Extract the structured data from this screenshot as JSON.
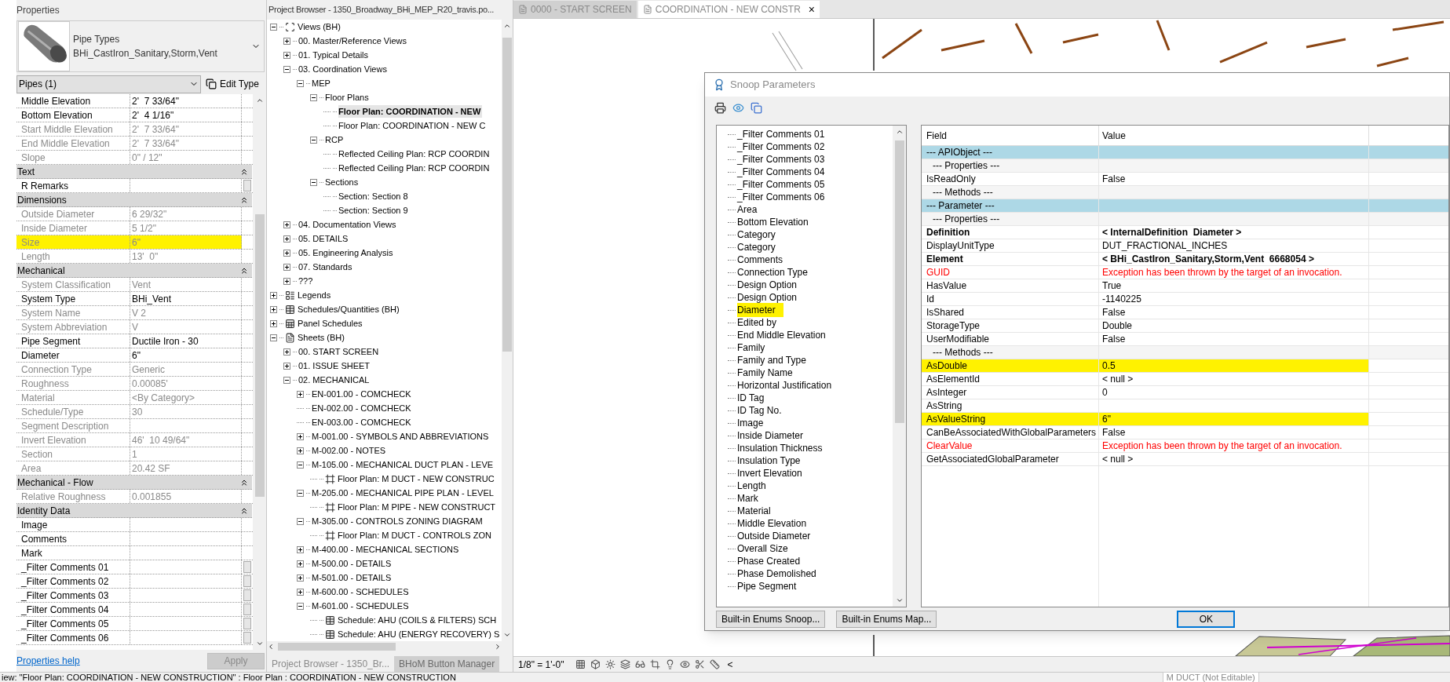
{
  "properties": {
    "title": "Properties",
    "type_family": "Pipe Types",
    "type_name": "BHi_CastIron_Sanitary,Storm,Vent",
    "instance_filter": "Pipes (1)",
    "edit_type": "Edit Type",
    "rows": [
      {
        "kind": "row",
        "label": "Middle Elevation",
        "value": "2'  7 33/64\"",
        "disabled": false
      },
      {
        "kind": "row",
        "label": "Bottom Elevation",
        "value": "2'  4 1/16\"",
        "disabled": false
      },
      {
        "kind": "row",
        "label": "Start Middle Elevation",
        "value": "2'  7 33/64\"",
        "disabled": true
      },
      {
        "kind": "row",
        "label": "End Middle Elevation",
        "value": "2'  7 33/64\"",
        "disabled": true
      },
      {
        "kind": "row",
        "label": "Slope",
        "value": "0\" / 12\"",
        "disabled": true
      },
      {
        "kind": "group",
        "label": "Text",
        "expanded": true
      },
      {
        "kind": "row",
        "label": "R Remarks",
        "disabled": false,
        "button": true
      },
      {
        "kind": "group",
        "label": "Dimensions",
        "expanded": true
      },
      {
        "kind": "row",
        "label": "Outside Diameter",
        "value": "6 29/32\"",
        "disabled": true
      },
      {
        "kind": "row",
        "label": "Inside Diameter",
        "value": "5 1/2\"",
        "disabled": true
      },
      {
        "kind": "row",
        "label": "Size",
        "value": "6\"",
        "disabled": true,
        "highlighted": true
      },
      {
        "kind": "row",
        "label": "Length",
        "value": "13'  0\"",
        "disabled": true
      },
      {
        "kind": "group",
        "label": "Mechanical",
        "expanded": true
      },
      {
        "kind": "row",
        "label": "System Classification",
        "value": "Vent",
        "disabled": true
      },
      {
        "kind": "row",
        "label": "System Type",
        "value": "BHi_Vent",
        "disabled": false
      },
      {
        "kind": "row",
        "label": "System Name",
        "value": "V 2",
        "disabled": true
      },
      {
        "kind": "row",
        "label": "System Abbreviation",
        "value": "V",
        "disabled": true
      },
      {
        "kind": "row",
        "label": "Pipe Segment",
        "value": "Ductile Iron - 30",
        "disabled": false
      },
      {
        "kind": "row",
        "label": "Diameter",
        "value": "6\"",
        "disabled": false
      },
      {
        "kind": "row",
        "label": "Connection Type",
        "value": "Generic",
        "disabled": true
      },
      {
        "kind": "row",
        "label": "Roughness",
        "value": "0.00085'",
        "disabled": true
      },
      {
        "kind": "row",
        "label": "Material",
        "value": "<By Category>",
        "disabled": true
      },
      {
        "kind": "row",
        "label": "Schedule/Type",
        "value": "30",
        "disabled": true
      },
      {
        "kind": "row",
        "label": "Segment Description",
        "disabled": true
      },
      {
        "kind": "row",
        "label": "Invert Elevation",
        "value": "46'  10 49/64\"",
        "disabled": true
      },
      {
        "kind": "row",
        "label": "Section",
        "value": "1",
        "disabled": true
      },
      {
        "kind": "row",
        "label": "Area",
        "value": "20.42 SF",
        "disabled": true
      },
      {
        "kind": "group",
        "label": "Mechanical - Flow",
        "expanded": true
      },
      {
        "kind": "row",
        "label": "Relative Roughness",
        "value": "0.001855",
        "disabled": true
      },
      {
        "kind": "group",
        "label": "Identity Data",
        "expanded": true
      },
      {
        "kind": "row",
        "label": "Image",
        "disabled": false
      },
      {
        "kind": "row",
        "label": "Comments",
        "disabled": false
      },
      {
        "kind": "row",
        "label": "Mark",
        "disabled": false
      },
      {
        "kind": "row",
        "label": "_Filter Comments 01",
        "disabled": false,
        "button": true
      },
      {
        "kind": "row",
        "label": "_Filter Comments 02",
        "disabled": false,
        "button": true
      },
      {
        "kind": "row",
        "label": "_Filter Comments 03",
        "disabled": false,
        "button": true
      },
      {
        "kind": "row",
        "label": "_Filter Comments 04",
        "disabled": false,
        "button": true
      },
      {
        "kind": "row",
        "label": "_Filter Comments 05",
        "disabled": false,
        "button": true
      },
      {
        "kind": "row",
        "label": "_Filter Comments 06",
        "disabled": false,
        "button": true
      }
    ],
    "help_link": "Properties help",
    "apply": {
      "label": "Apply",
      "disabled": true
    }
  },
  "project_browser": {
    "title": "Project Browser - 1350_Broadway_BHi_MEP_R20_travis.po...",
    "tree": [
      {
        "label": "Views (BH)",
        "kind": "views",
        "expanded": true,
        "children": [
          {
            "label": "00. Master/Reference Views",
            "expanded": false
          },
          {
            "label": "01. Typical Details",
            "expanded": false
          },
          {
            "label": "03. Coordination Views",
            "expanded": true,
            "children": [
              {
                "label": "MEP",
                "expanded": true,
                "children": [
                  {
                    "label": "Floor Plans",
                    "expanded": true,
                    "children": [
                      {
                        "label": "Floor Plan: COORDINATION - NEW",
                        "active": true
                      },
                      {
                        "label": "Floor Plan: COORDINATION - NEW C"
                      }
                    ]
                  },
                  {
                    "label": "RCP",
                    "expanded": true,
                    "children": [
                      {
                        "label": "Reflected Ceiling Plan: RCP COORDIN"
                      },
                      {
                        "label": "Reflected Ceiling Plan: RCP COORDIN"
                      }
                    ]
                  },
                  {
                    "label": "Sections",
                    "expanded": true,
                    "children": [
                      {
                        "label": "Section: Section 8"
                      },
                      {
                        "label": "Section: Section 9"
                      }
                    ]
                  }
                ]
              }
            ]
          },
          {
            "label": "04. Documentation Views",
            "expanded": false
          },
          {
            "label": "05. DETAILS",
            "expanded": false
          },
          {
            "label": "05. Engineering Analysis",
            "expanded": false
          },
          {
            "label": "07. Standards",
            "expanded": false
          },
          {
            "label": "???",
            "expanded": false
          }
        ]
      },
      {
        "label": "Legends",
        "kind": "legend",
        "expanded": false
      },
      {
        "label": "Schedules/Quantities (BH)",
        "kind": "schedule",
        "expanded": false
      },
      {
        "label": "Panel Schedules",
        "kind": "panel",
        "expanded": false
      },
      {
        "label": "Sheets (BH)",
        "kind": "sheet",
        "expanded": true,
        "children": [
          {
            "label": "00. START SCREEN",
            "expanded": false
          },
          {
            "label": "01. ISSUE SHEET",
            "expanded": false
          },
          {
            "label": "02. MECHANICAL",
            "expanded": true,
            "children": [
              {
                "label": "EN-001.00 - COMCHECK",
                "expanded": false
              },
              {
                "label": "EN-002.00 - COMCHECK"
              },
              {
                "label": "EN-003.00 - COMCHECK"
              },
              {
                "label": "M-001.00 - SYMBOLS AND ABBREVIATIONS",
                "expanded": false
              },
              {
                "label": "M-002.00 - NOTES",
                "expanded": false
              },
              {
                "label": "M-105.00 - MECHANICAL DUCT PLAN - LEVE",
                "expanded": true,
                "children": [
                  {
                    "label": "Floor Plan: M DUCT - NEW CONSTRUC",
                    "kind": "view"
                  }
                ]
              },
              {
                "label": "M-205.00 - MECHANICAL PIPE PLAN - LEVEL",
                "expanded": true,
                "children": [
                  {
                    "label": "Floor Plan: M PIPE - NEW CONSTRUCT",
                    "kind": "view"
                  }
                ]
              },
              {
                "label": "M-305.00 - CONTROLS ZONING DIAGRAM",
                "expanded": true,
                "children": [
                  {
                    "label": "Floor Plan: M DUCT - CONTROLS ZON",
                    "kind": "view"
                  }
                ]
              },
              {
                "label": "M-400.00 - MECHANICAL SECTIONS",
                "expanded": false
              },
              {
                "label": "M-500.00 - DETAILS",
                "expanded": false
              },
              {
                "label": "M-501.00 - DETAILS",
                "expanded": false
              },
              {
                "label": "M-600.00 - SCHEDULES",
                "expanded": false
              },
              {
                "label": "M-601.00 - SCHEDULES",
                "expanded": true,
                "children": [
                  {
                    "label": "Schedule: AHU (COILS & FILTERS) SCH",
                    "kind": "schedule"
                  },
                  {
                    "label": "Schedule: AHU (ENERGY RECOVERY) S",
                    "kind": "schedule"
                  }
                ]
              }
            ]
          }
        ]
      }
    ],
    "tabs": [
      {
        "label": "Project Browser - 1350_Br...",
        "selected": true
      },
      {
        "label": "BHoM Button Manager",
        "selected": false
      }
    ]
  },
  "view_tabs": [
    {
      "label": "0000 - START SCREEN",
      "selected": false
    },
    {
      "label": "COORDINATION - NEW CONSTR",
      "selected": true,
      "close": "×"
    }
  ],
  "view_control_bar": {
    "scale": "1/8\" = 1'-0\"",
    "collapse": "<"
  },
  "snoop": {
    "title": "Snoop Parameters",
    "parameters": [
      {
        "label": "_Filter Comments 01"
      },
      {
        "label": "_Filter Comments 02"
      },
      {
        "label": "_Filter Comments 03"
      },
      {
        "label": "_Filter Comments 04"
      },
      {
        "label": "_Filter Comments 05"
      },
      {
        "label": "_Filter Comments 06"
      },
      {
        "label": "Area"
      },
      {
        "label": "Bottom Elevation"
      },
      {
        "label": "Category"
      },
      {
        "label": "Category"
      },
      {
        "label": "Comments"
      },
      {
        "label": "Connection Type"
      },
      {
        "label": "Design Option"
      },
      {
        "label": "Design Option"
      },
      {
        "label": "Diameter",
        "highlighted": true
      },
      {
        "label": "Edited by"
      },
      {
        "label": "End Middle Elevation"
      },
      {
        "label": "Family"
      },
      {
        "label": "Family and Type"
      },
      {
        "label": "Family Name"
      },
      {
        "label": "Horizontal Justification"
      },
      {
        "label": "ID Tag"
      },
      {
        "label": "ID Tag No."
      },
      {
        "label": "Image"
      },
      {
        "label": "Inside Diameter"
      },
      {
        "label": "Insulation Thickness"
      },
      {
        "label": "Insulation Type"
      },
      {
        "label": "Invert Elevation"
      },
      {
        "label": "Length"
      },
      {
        "label": "Mark"
      },
      {
        "label": "Material"
      },
      {
        "label": "Middle Elevation"
      },
      {
        "label": "Outside Diameter"
      },
      {
        "label": "Overall Size"
      },
      {
        "label": "Phase Created"
      },
      {
        "label": "Phase Demolished"
      },
      {
        "label": "Pipe Segment"
      }
    ],
    "columns": [
      "Field",
      "Value"
    ],
    "rows": [
      {
        "kind": "section",
        "field": "--- APIObject ---"
      },
      {
        "kind": "subsection",
        "field": "--- Properties ---"
      },
      {
        "kind": "normal",
        "field": "IsReadOnly",
        "value": "False"
      },
      {
        "kind": "subsection",
        "field": "--- Methods ---"
      },
      {
        "kind": "section",
        "field": "--- Parameter ---"
      },
      {
        "kind": "subsection",
        "field": "--- Properties ---"
      },
      {
        "kind": "bold",
        "field": "Definition",
        "value": "< InternalDefinition  Diameter >"
      },
      {
        "kind": "normal",
        "field": "DisplayUnitType",
        "value": "DUT_FRACTIONAL_INCHES"
      },
      {
        "kind": "bold",
        "field": "Element",
        "value": "< BHi_CastIron_Sanitary,Storm,Vent  6668054 >"
      },
      {
        "kind": "error",
        "field": "GUID",
        "value": "Exception has been thrown by the target of an invocation."
      },
      {
        "kind": "normal",
        "field": "HasValue",
        "value": "True"
      },
      {
        "kind": "normal",
        "field": "Id",
        "value": "-1140225"
      },
      {
        "kind": "normal",
        "field": "IsShared",
        "value": "False"
      },
      {
        "kind": "normal",
        "field": "StorageType",
        "value": "Double"
      },
      {
        "kind": "normal",
        "field": "UserModifiable",
        "value": "False"
      },
      {
        "kind": "subsection",
        "field": "--- Methods ---"
      },
      {
        "kind": "normal",
        "field": "AsDouble",
        "value": "0.5",
        "highlighted": true
      },
      {
        "kind": "normal",
        "field": "AsElementId",
        "value": "< null >"
      },
      {
        "kind": "normal",
        "field": "AsInteger",
        "value": "0"
      },
      {
        "kind": "normal",
        "field": "AsString"
      },
      {
        "kind": "normal",
        "field": "AsValueString",
        "value": "6\"",
        "highlighted": true
      },
      {
        "kind": "normal",
        "field": "CanBeAssociatedWithGlobalParameters",
        "value": "False"
      },
      {
        "kind": "error",
        "field": "ClearValue",
        "value": "Exception has been thrown by the target of an invocation."
      },
      {
        "kind": "normal",
        "field": "GetAssociatedGlobalParameter",
        "value": "< null >"
      }
    ],
    "buttons": [
      "Built-in Enums Snoop...",
      "Built-in Enums Map..."
    ],
    "ok": "OK"
  },
  "status_bar": {
    "text": "iew: \"Floor Plan: COORDINATION - NEW CONSTRUCTION\" : Floor Plan : COORDINATION - NEW CONSTRUCTION",
    "view_field": "M DUCT (Not Editable)"
  }
}
